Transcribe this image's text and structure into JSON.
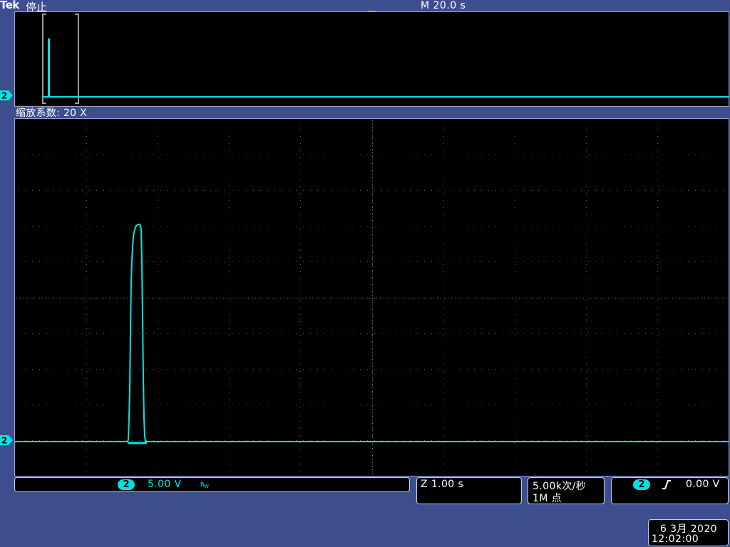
{
  "header": {
    "brand": "Tek",
    "run_state": "停止",
    "timebase": "M 20.0 s"
  },
  "zoom": {
    "factor_label": "缩放系数: 20 X"
  },
  "channel": {
    "number": "2",
    "scale": "5.00 V",
    "bandwidth_icon": "bandwidth-limit-icon",
    "color": "#00e5e5"
  },
  "zoom_time": "Z 1.00 s",
  "acquisition": {
    "sample_rate": "5.00k次/秒",
    "record_length": "1M 点"
  },
  "trigger": {
    "channel": "2",
    "slope_icon": "rising-edge-icon",
    "level": "0.00 V"
  },
  "datetime": {
    "date": "6 3月  2020",
    "time": "12:02:00"
  },
  "colors": {
    "background": "#3d4e8f",
    "trace": "#00e5e5",
    "trigger_marker": "#f5a623"
  }
}
